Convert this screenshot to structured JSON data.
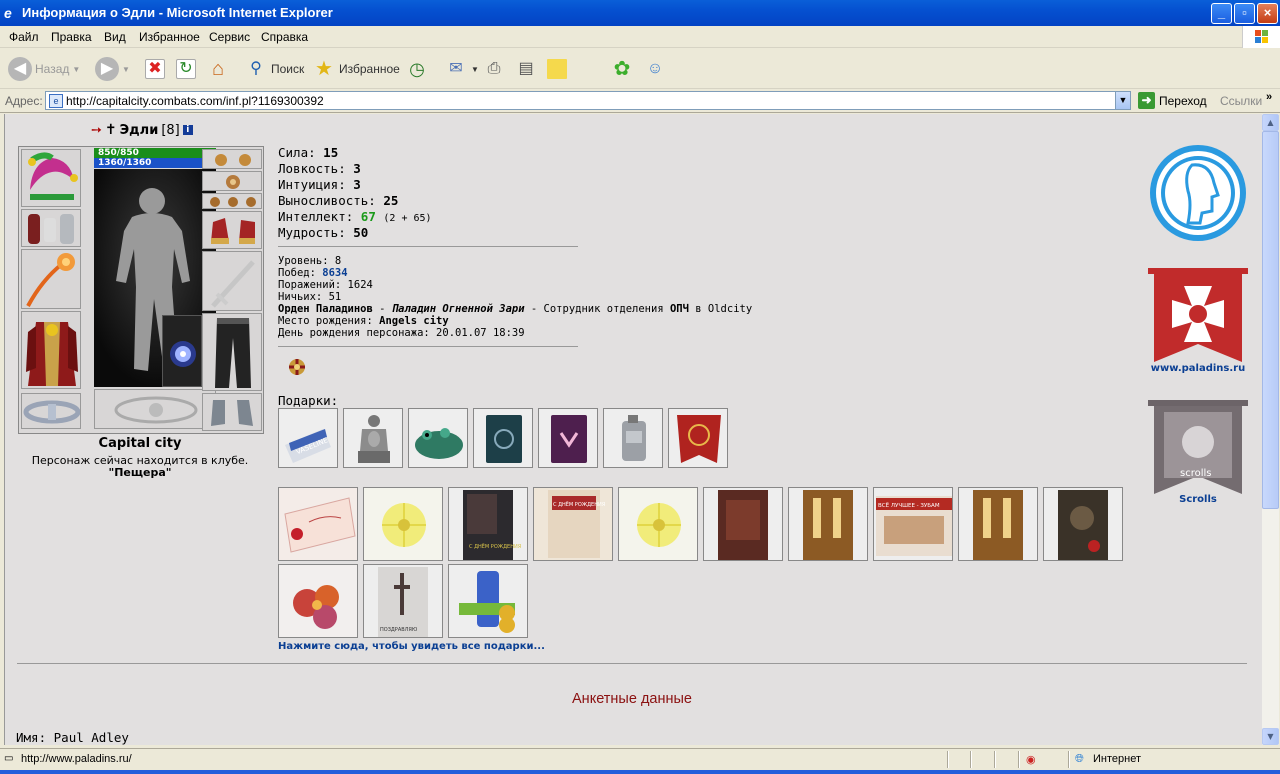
{
  "window": {
    "title": "Информация о Эдли - Microsoft Internet Explorer",
    "minimize": "_",
    "maximize": "▫",
    "close": "×"
  },
  "menu": [
    "Файл",
    "Правка",
    "Вид",
    "Избранное",
    "Сервис",
    "Справка"
  ],
  "toolbar": {
    "back": "Назад",
    "search": "Поиск",
    "favorites": "Избранное"
  },
  "address": {
    "label": "Адрес:",
    "url": "http://capitalcity.combats.com/inf.pl?1169300392",
    "go": "Переход",
    "links": "Ссылки"
  },
  "character": {
    "name": "Эдли",
    "level_badge": "[8]",
    "hp": "850/850",
    "mana": "1360/1360",
    "city": "Capital city",
    "location_text": "Персонаж сейчас находится в клубе.",
    "club": "\"Пещера\""
  },
  "stats": [
    {
      "label": "Сила:",
      "value": "15"
    },
    {
      "label": "Ловкость:",
      "value": "3"
    },
    {
      "label": "Интуиция:",
      "value": "3"
    },
    {
      "label": "Выносливость:",
      "value": "25"
    },
    {
      "label": "Интеллект:",
      "value": "67",
      "extra": "(2 + 65)"
    },
    {
      "label": "Мудрость:",
      "value": "50"
    }
  ],
  "info": {
    "level_label": "Уровень:",
    "level": "8",
    "wins_label": "Побед:",
    "wins": "8634",
    "losses_label": "Поражений:",
    "losses": "1624",
    "draws_label": "Ничьих:",
    "draws": "51",
    "order": "Орден Паладинов",
    "order_dash": " - ",
    "rank": "Паладин Огненной Зари",
    "staff_text": " - Сотрудник отделения ",
    "dept": "ОПЧ",
    "in_city": " в Oldcity",
    "birthplace_label": "Место рождения:",
    "birthplace": "Angels city",
    "birthday_label": "День рождения персонажа:",
    "birthday": "20.01.07 18:39"
  },
  "gifts_label": "Подарки:",
  "all_gifts_link": "Нажмите сюда, чтобы увидеть все подарки...",
  "gift_texts": {
    "vaseline": "VASELINE",
    "birthday": "С ДНЁМ РОЖДЕНИЯ",
    "happy_birthday": "С ДНЁМ РОЖДЕНИЯ",
    "best_teeth": "ВСЁ ЛУЧШЕЕ - ЗУБАМ",
    "congrats": "ПОЗДРАВЛЯЮ",
    "scrolls": "scrolls"
  },
  "profile_title": "Анкетные данные",
  "name_label": "Имя:",
  "name_value": "Paul Adley",
  "emblems": {
    "paladins_link": "www.paladins.ru",
    "scrolls_link": "Scrolls"
  },
  "status": {
    "url": "http://www.paladins.ru/",
    "zone": "Интернет"
  }
}
